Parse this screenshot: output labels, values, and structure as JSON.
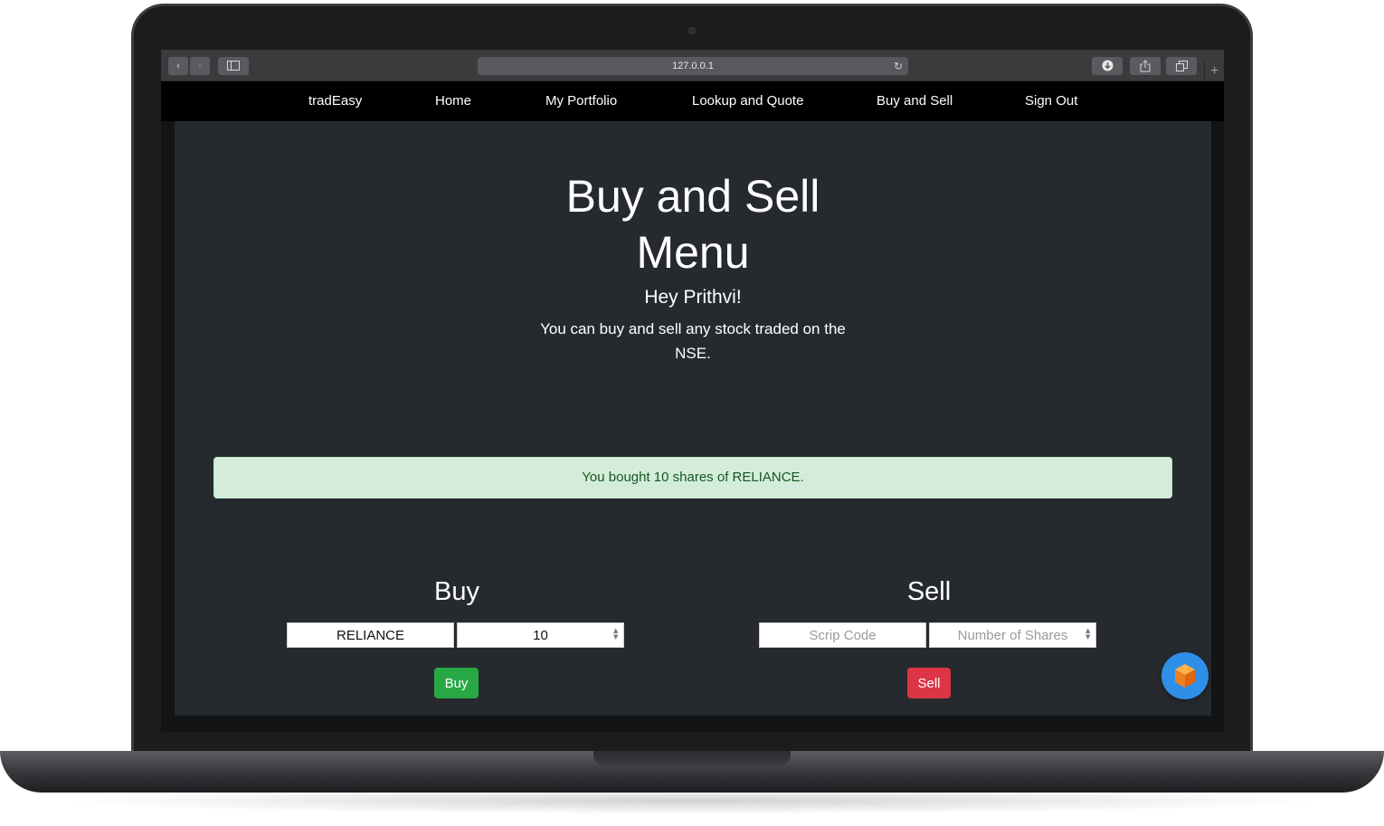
{
  "browser": {
    "url": "127.0.0.1",
    "icons": {
      "back": "chevron-left-icon",
      "forward": "chevron-right-icon",
      "sidebar": "sidebar-icon",
      "reload": "reload-icon",
      "download": "download-icon",
      "share": "share-icon",
      "tabs": "tabs-icon",
      "new_tab": "plus-icon"
    }
  },
  "nav": {
    "brand": "tradEasy",
    "items": [
      "Home",
      "My Portfolio",
      "Lookup and Quote",
      "Buy and Sell",
      "Sign Out"
    ]
  },
  "page": {
    "title_line1": "Buy and Sell",
    "title_line2": "Menu",
    "greeting": "Hey Prithvi!",
    "lead": "You can buy and sell any stock traded on the NSE.",
    "alert": "You bought 10 shares of RELIANCE."
  },
  "buy": {
    "title": "Buy",
    "scrip_value": "RELIANCE",
    "shares_value": "10",
    "button": "Buy"
  },
  "sell": {
    "title": "Sell",
    "scrip_placeholder": "Scrip Code",
    "shares_placeholder": "Number of Shares",
    "button": "Sell"
  },
  "colors": {
    "page_bg": "#262a2f",
    "nav_bg": "#000000",
    "alert_bg": "#d4edda",
    "alert_text": "#155724",
    "buy_button": "#28a745",
    "sell_button": "#dc3545",
    "fab": "#2f8fe8"
  },
  "fab": {
    "icon": "cube-icon"
  }
}
